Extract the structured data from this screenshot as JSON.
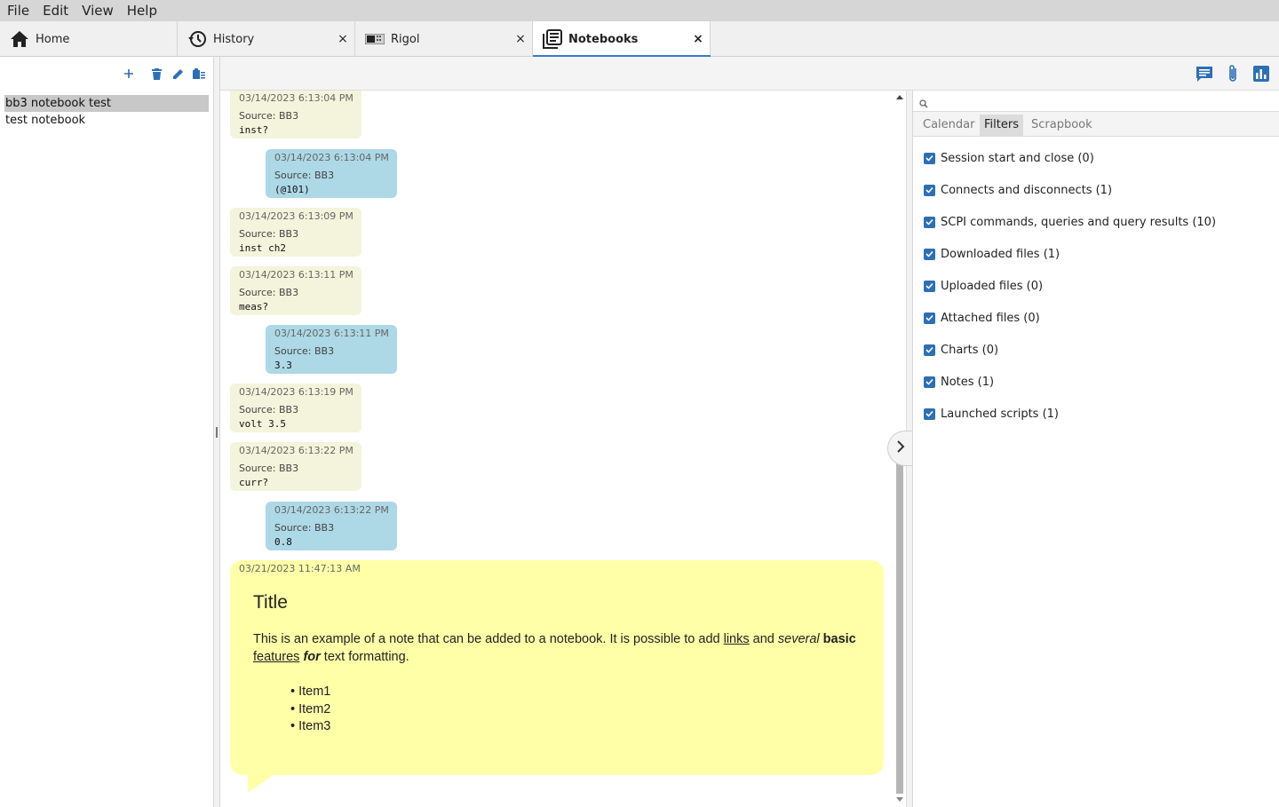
{
  "menu": [
    "File",
    "Edit",
    "View",
    "Help"
  ],
  "tabs": [
    {
      "label": "Home",
      "icon": "home-icon",
      "closable": false
    },
    {
      "label": "History",
      "icon": "history-icon",
      "closable": true
    },
    {
      "label": "Rigol",
      "icon": "instrument-icon",
      "closable": true
    },
    {
      "label": "Notebooks",
      "icon": "notebooks-icon",
      "closable": true
    }
  ],
  "close_glyph": "×",
  "notebooks": {
    "items": [
      "bb3 notebook test",
      "test notebook"
    ],
    "selected": 0
  },
  "history": {
    "entries": [
      {
        "kind": "request",
        "time": "03/14/2023 6:13:04 PM",
        "source": "Source: BB3",
        "value": "inst?"
      },
      {
        "kind": "response",
        "time": "03/14/2023 6:13:04 PM",
        "source": "Source: BB3",
        "value": "(@101)"
      },
      {
        "kind": "request",
        "time": "03/14/2023 6:13:09 PM",
        "source": "Source: BB3",
        "value": "inst ch2"
      },
      {
        "kind": "request",
        "time": "03/14/2023 6:13:11 PM",
        "source": "Source: BB3",
        "value": "meas?"
      },
      {
        "kind": "response",
        "time": "03/14/2023 6:13:11 PM",
        "source": "Source: BB3",
        "value": "3.3"
      },
      {
        "kind": "request",
        "time": "03/14/2023 6:13:19 PM",
        "source": "Source: BB3",
        "value": "volt 3.5"
      },
      {
        "kind": "request",
        "time": "03/14/2023 6:13:22 PM",
        "source": "Source: BB3",
        "value": "curr?"
      },
      {
        "kind": "response",
        "time": "03/14/2023 6:13:22 PM",
        "source": "Source: BB3",
        "value": "0.8"
      }
    ],
    "note": {
      "time": "03/21/2023 11:47:13 AM",
      "title": "Title",
      "text_1": "This is an example of a note that can be added to a notebook. It is possible to add ",
      "link_1": "links",
      "text_2": " and ",
      "italic_1": "several",
      "text_3": " ",
      "bold_1": "basic",
      "text_4": " ",
      "link_2": "features",
      "text_5": " ",
      "bold_italic_1": "for",
      "text_6": " text formatting.",
      "items": [
        "Item1",
        "Item2",
        "Item3"
      ]
    }
  },
  "right_panel": {
    "search_placeholder": "",
    "subtabs": [
      "Calendar",
      "Filters",
      "Scrapbook"
    ],
    "active_subtab": 1,
    "filters": [
      {
        "label": "Session start and close (0)",
        "checked": true
      },
      {
        "label": "Connects and disconnects (1)",
        "checked": true
      },
      {
        "label": "SCPI commands, queries and query results (10)",
        "checked": true
      },
      {
        "label": "Downloaded files (1)",
        "checked": true
      },
      {
        "label": "Uploaded files (0)",
        "checked": true
      },
      {
        "label": "Attached files (0)",
        "checked": true
      },
      {
        "label": "Charts (0)",
        "checked": true
      },
      {
        "label": "Notes (1)",
        "checked": true
      },
      {
        "label": "Launched scripts (1)",
        "checked": true
      }
    ]
  },
  "colors": {
    "accent": "#3a7bc8",
    "request_bubble": "#f4f4dc",
    "response_bubble": "#add8e6",
    "note_bubble": "#ffffa8",
    "checkbox": "#2d6fb5"
  }
}
